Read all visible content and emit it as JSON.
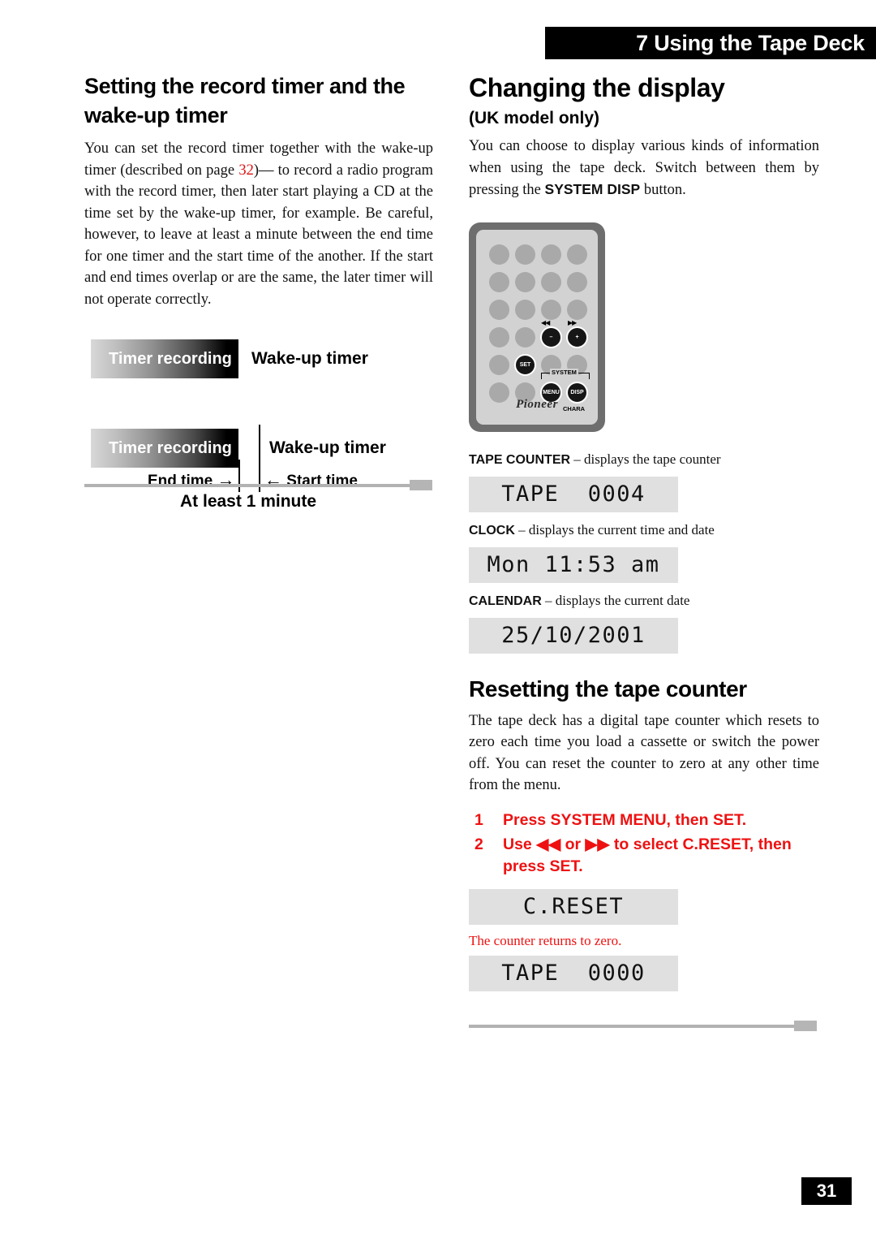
{
  "running_head": "7 Using the Tape Deck",
  "page_number": "31",
  "left_column": {
    "heading": "Setting the record timer and the wake-up timer",
    "intro_part1": "You can set the record timer together with the wake-up timer (described on page ",
    "intro_pageref": "32",
    "intro_part2": ")— to record a radio program with the record timer, then later start playing a CD at the time set by the wake-up timer, for example. Be careful, however, to leave at least a minute between the end time for one timer and the start time of the another. If the start and end times overlap or are the same, the later timer will not operate correctly.",
    "figure": {
      "bar_label_1": "Timer recording",
      "wake_label_1": "Wake-up timer",
      "bar_label_2": "Timer recording",
      "wake_label_2": "Wake-up timer",
      "end_time_label": "End time",
      "end_time_arrow": "→",
      "start_time_arrow": "←",
      "start_time_label": "Start time",
      "gap_label": "At least 1 minute"
    }
  },
  "right_column": {
    "heading": "Changing the display",
    "subheading": "(UK model only)",
    "intro_part1": "You can choose to display various kinds of information when using the tape deck. Switch between them by pressing the ",
    "intro_bold": "SYSTEM DISP",
    "intro_part2": " button.",
    "remote": {
      "brand": "Pioneer",
      "minus_button": "–",
      "plus_button": "+",
      "set_button": "SET",
      "menu_button": "MENU",
      "disp_button": "DISP",
      "system_bracket_label": "SYSTEM",
      "chara_label": "CHARA",
      "skip_back_label": "◀◀",
      "skip_fwd_label": "▶▶"
    },
    "display_modes": [
      {
        "name": "TAPE COUNTER",
        "dash": " – ",
        "description": "displays the tape counter",
        "lcd": "TAPE  0004"
      },
      {
        "name": "CLOCK",
        "dash": " – ",
        "description": "displays the current time and date",
        "lcd": "Mon 11:53 am"
      },
      {
        "name": "CALENDAR",
        "dash": " – ",
        "description": "displays the current date",
        "lcd": "25/10/2001"
      }
    ],
    "reset_heading": "Resetting the tape counter",
    "reset_body": "The tape deck has a digital tape counter which resets to zero each time you load a cassette or switch the power off. You can reset the counter to zero at any other time from the menu.",
    "steps": [
      {
        "num": "1",
        "text": "Press SYSTEM MENU, then SET."
      },
      {
        "num": "2",
        "text": "Use ◀◀ or ▶▶ to select C.RESET, then press SET."
      }
    ],
    "reset_lcd_1": "C.RESET",
    "reset_note": "The counter returns to zero.",
    "reset_lcd_2": "TAPE  0000"
  }
}
